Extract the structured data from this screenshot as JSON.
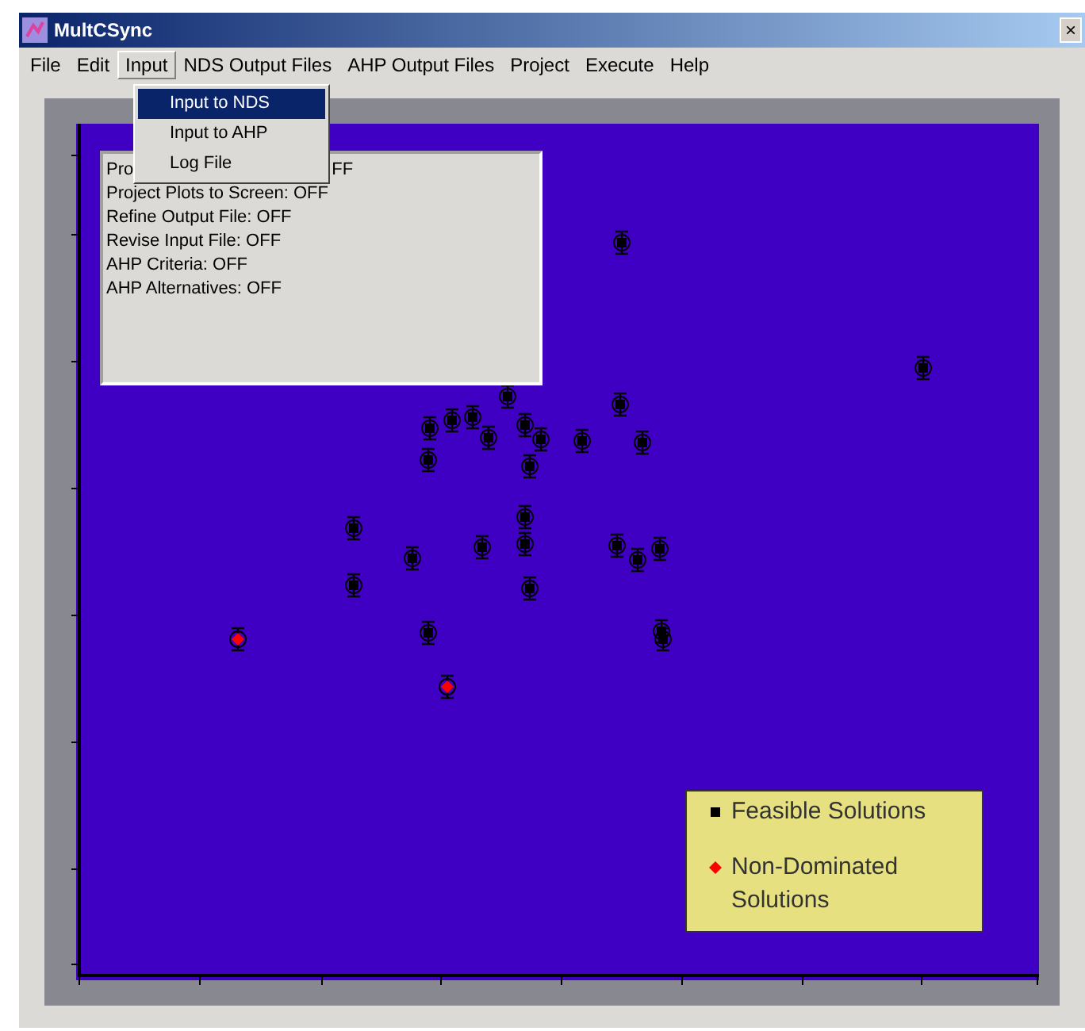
{
  "window": {
    "title": "MultCSync",
    "close": "×"
  },
  "menu": [
    {
      "label": "File",
      "selected": false
    },
    {
      "label": "Edit",
      "selected": false
    },
    {
      "label": "Input",
      "selected": true
    },
    {
      "label": "NDS Output Files",
      "selected": false
    },
    {
      "label": "AHP Output Files",
      "selected": false
    },
    {
      "label": "Project",
      "selected": false
    },
    {
      "label": "Execute",
      "selected": false
    },
    {
      "label": "Help",
      "selected": false
    }
  ],
  "dropdown": [
    {
      "label": "Input to NDS",
      "selected": true
    },
    {
      "label": "Input to AHP",
      "selected": false
    },
    {
      "label": "Log File",
      "selected": false
    }
  ],
  "settings_panel": [
    {
      "parts": [
        "Pro",
        "FF"
      ]
    },
    {
      "parts": [
        "Project Plots to Screen: OFF"
      ]
    },
    {
      "parts": [
        "Refine Output File: OFF"
      ]
    },
    {
      "parts": [
        "Revise Input File: OFF"
      ]
    },
    {
      "parts": [
        "AHP Criteria: OFF"
      ]
    },
    {
      "parts": [
        "AHP Alternatives: OFF"
      ]
    }
  ],
  "legend": [
    {
      "label": "Feasible Solutions",
      "color": "#000000"
    },
    {
      "label": "Non-Dominated Solutions",
      "color": "#ff0000"
    }
  ]
}
